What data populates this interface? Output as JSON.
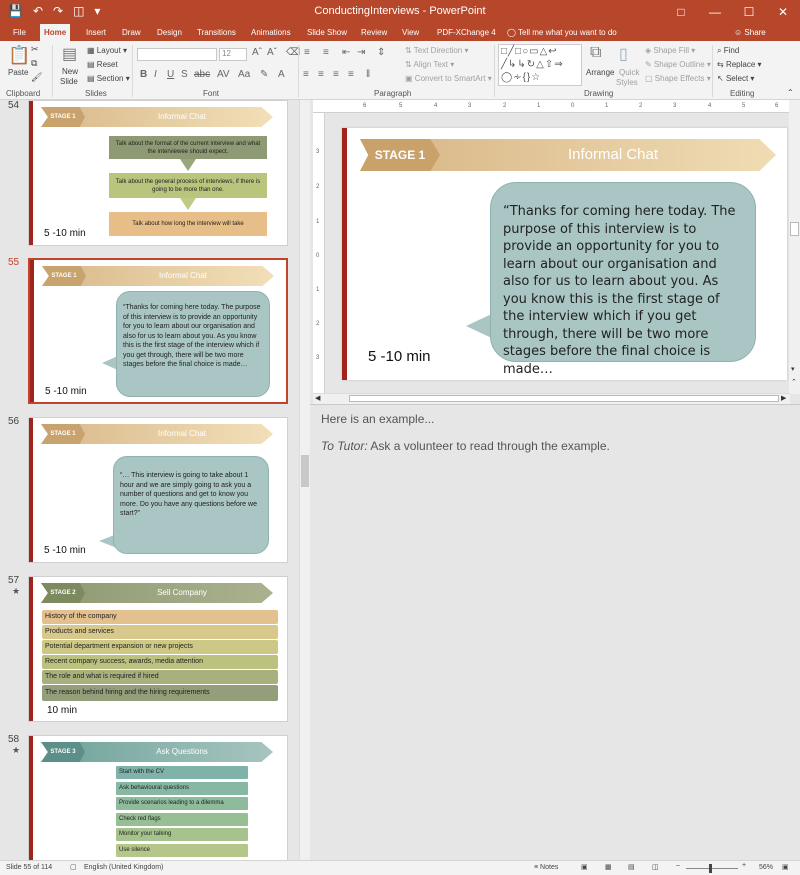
{
  "app": {
    "title": "ConductingInterviews  -  PowerPoint",
    "share": "Share",
    "tell_me": "Tell me what you want to do",
    "accent": "#b7472a"
  },
  "tabs": [
    "File",
    "Home",
    "Insert",
    "Draw",
    "Design",
    "Transitions",
    "Animations",
    "Slide Show",
    "Review",
    "View",
    "PDF-XChange 4"
  ],
  "active_tab": "Home",
  "ribbon": {
    "clipboard": {
      "label": "Clipboard",
      "paste": "Paste"
    },
    "slides": {
      "label": "Slides",
      "new_slide_1": "New",
      "new_slide_2": "Slide",
      "layout": "Layout",
      "reset": "Reset",
      "section": "Section"
    },
    "font": {
      "label": "Font",
      "font_size": "12"
    },
    "paragraph": {
      "label": "Paragraph",
      "text_direction": "Text Direction",
      "align_text": "Align Text",
      "convert_smartart": "Convert to SmartArt"
    },
    "drawing": {
      "label": "Drawing",
      "arrange": "Arrange",
      "quick_styles_1": "Quick",
      "quick_styles_2": "Styles",
      "shape_fill": "Shape Fill",
      "shape_outline": "Shape Outline",
      "shape_effects": "Shape Effects"
    },
    "editing": {
      "label": "Editing",
      "find": "Find",
      "replace": "Replace",
      "select": "Select"
    }
  },
  "thumbnails": [
    {
      "num": "54",
      "stage": "STAGE 1",
      "title": "Informal Chat",
      "boxes": [
        "Talk about the format of the current interview and what the interviewee should expect.",
        "Talk about the general process of interviews, if there is going to be more than one.",
        "Talk about how long the interview will take"
      ],
      "duration": "5 -10 min"
    },
    {
      "num": "55",
      "stage": "STAGE 1",
      "title": "Informal Chat",
      "quote": "“Thanks for coming here today. The purpose of this interview is to provide an opportunity for you to learn about our organisation and also for us to learn about you. As you know this is the first stage of the interview which if you get through, there will be two more stages before the final choice is made…",
      "duration": "5 -10 min"
    },
    {
      "num": "56",
      "stage": "STAGE 1",
      "title": "Informal Chat",
      "quote": "“… This interview is going to take about 1 hour and we are simply going to ask you a number of questions and get to know you more. Do you have any questions before we start?”",
      "duration": "5 -10 min"
    },
    {
      "num": "57",
      "star": "★",
      "stage": "STAGE 2",
      "title": "Sell Company",
      "rows": [
        "History of the company",
        "Products and services",
        "Potential department expansion or new projects",
        "Recent company success, awards, media attention",
        "The role and what is required if hired",
        "The reason behind hiring and the hiring requirements"
      ],
      "duration": "10 min"
    },
    {
      "num": "58",
      "star": "★",
      "stage": "STAGE 3",
      "title": "Ask Questions",
      "rows": [
        "Start with the CV",
        "Ask behavioural questions",
        "Provide scenarios leading to a dilemma",
        "Check red flags",
        "Monitor your talking",
        "Use silence"
      ]
    }
  ],
  "main_slide": {
    "stage": "STAGE 1",
    "title": "Informal Chat",
    "quote": "“Thanks for coming here today. The purpose of this interview is to provide an opportunity for you to learn about our organisation and also for us to learn about you. As you know this is the first stage of the interview which if you get through, there will be two more stages before the final choice is made…",
    "duration": "5 -10 min"
  },
  "notes": {
    "line1": "Here is an example...",
    "tutor_label": "To Tutor:",
    "tutor_text": " Ask a volunteer to read through the example."
  },
  "status": {
    "slide_info": "Slide 55 of 114",
    "language": "English (United Kingdom)",
    "notes_button": "Notes",
    "zoom": "56%"
  },
  "ruler_h_ticks": [
    "6",
    "5",
    "4",
    "3",
    "2",
    "1",
    "0",
    "1",
    "2",
    "3",
    "4",
    "5",
    "6"
  ],
  "ruler_v_ticks": [
    "3",
    "2",
    "1",
    "0",
    "1",
    "2",
    "3"
  ]
}
